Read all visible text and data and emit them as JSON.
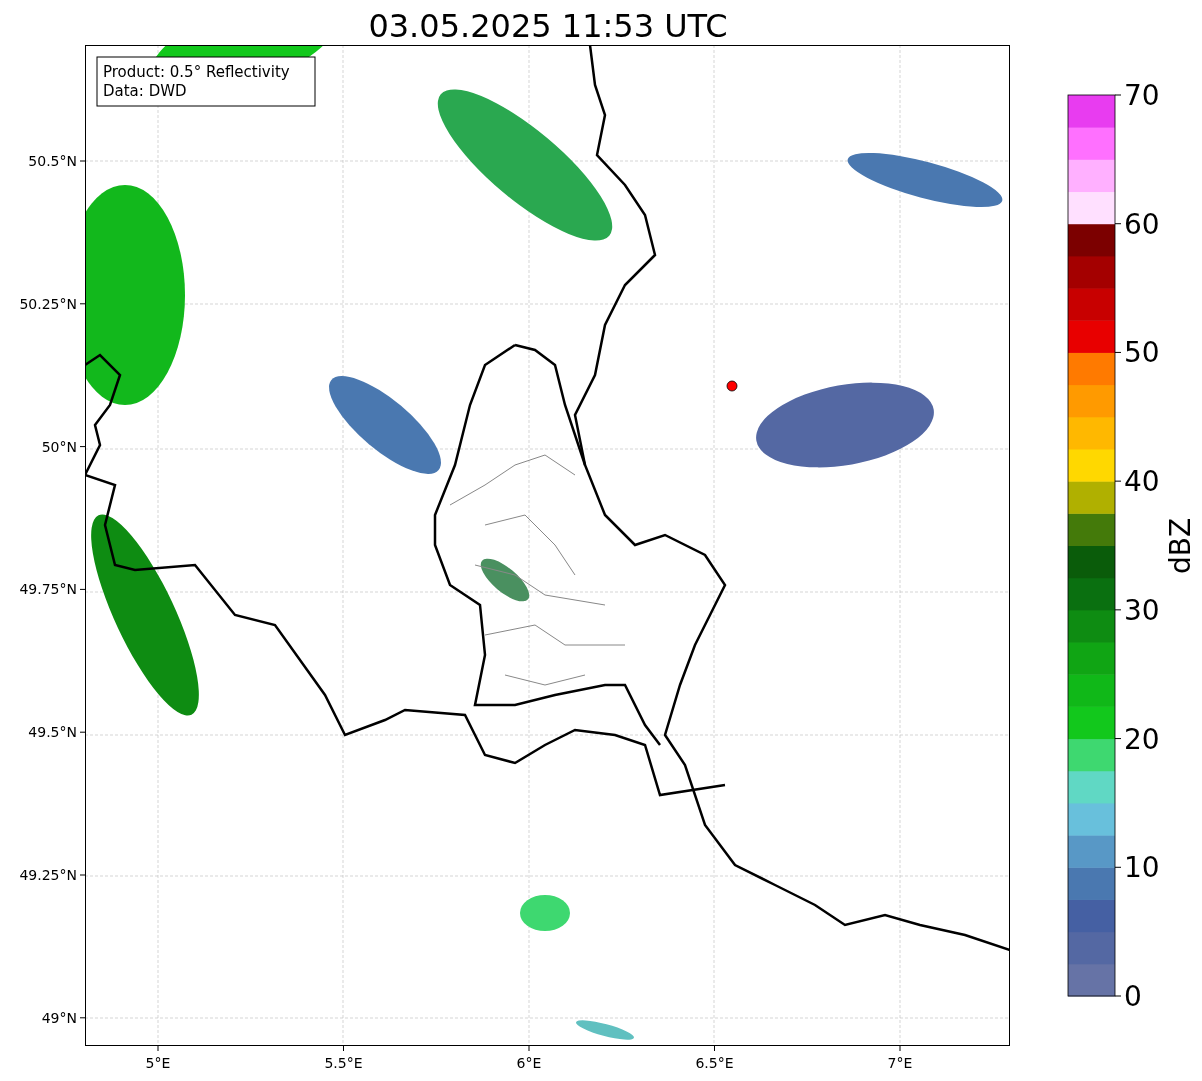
{
  "title": "03.05.2025 11:53 UTC",
  "legend": [
    "Product: 0.5° Reflectivity",
    "Data: DWD"
  ],
  "map": {
    "y_ticks": [
      "50.5°N",
      "50.25°N",
      "50°N",
      "49.75°N",
      "49.5°N",
      "49.25°N",
      "49°N"
    ],
    "x_ticks": [
      "5°E",
      "5.5°E",
      "6°E",
      "6.5°E",
      "7°E"
    ]
  },
  "colorbar": {
    "label": "dBZ",
    "ticks": [
      "70",
      "60",
      "50",
      "40",
      "30",
      "20",
      "10",
      "0"
    ],
    "bands": [
      {
        "color": "#6673a6"
      },
      {
        "color": "#5468a3"
      },
      {
        "color": "#4560a3"
      },
      {
        "color": "#4a78b0"
      },
      {
        "color": "#5898c6"
      },
      {
        "color": "#68c0dc"
      },
      {
        "color": "#60d8c4"
      },
      {
        "color": "#3ed870"
      },
      {
        "color": "#12c81c"
      },
      {
        "color": "#10b818"
      },
      {
        "color": "#10a514"
      },
      {
        "color": "#0e8c12"
      },
      {
        "color": "#0a7010"
      },
      {
        "color": "#0a5c0a"
      },
      {
        "color": "#447a0a"
      },
      {
        "color": "#b0b000"
      },
      {
        "color": "#ffd800"
      },
      {
        "color": "#ffb800"
      },
      {
        "color": "#ff9a00"
      },
      {
        "color": "#ff7a00"
      },
      {
        "color": "#e80000"
      },
      {
        "color": "#c80000"
      },
      {
        "color": "#a40000"
      },
      {
        "color": "#7c0000"
      },
      {
        "color": "#ffe0ff"
      },
      {
        "color": "#ffb0ff"
      },
      {
        "color": "#ff70ff"
      },
      {
        "color": "#e83cf0"
      }
    ]
  }
}
